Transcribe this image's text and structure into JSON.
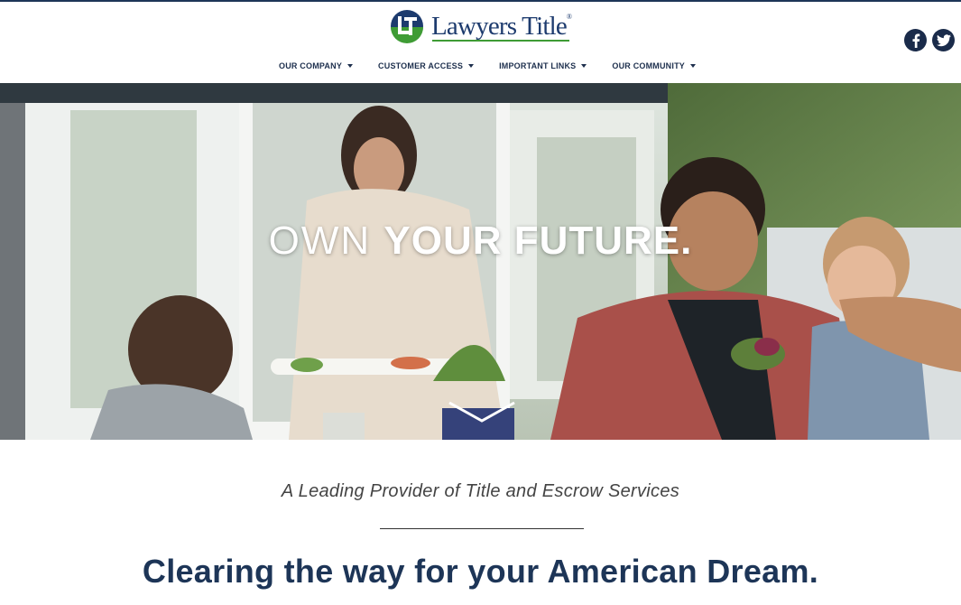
{
  "brand": {
    "name": "Lawyers Title",
    "trademark": "®",
    "colors": {
      "navy": "#1d3557",
      "green": "#3f9c35",
      "social": "#1a2b4a"
    }
  },
  "social": [
    {
      "name": "facebook-icon",
      "glyph": "f"
    },
    {
      "name": "twitter-icon",
      "glyph": "bird"
    }
  ],
  "nav": {
    "items": [
      {
        "label": "OUR COMPANY"
      },
      {
        "label": "CUSTOMER ACCESS"
      },
      {
        "label": "IMPORTANT LINKS"
      },
      {
        "label": "OUR COMMUNITY"
      }
    ]
  },
  "hero": {
    "title_thin": "OWN ",
    "title_bold": "YOUR FUTURE.",
    "scroll_icon": "chevron-down-icon"
  },
  "content": {
    "tagline": "A Leading Provider of Title and Escrow Services",
    "headline": "Clearing the way for your American Dream."
  }
}
